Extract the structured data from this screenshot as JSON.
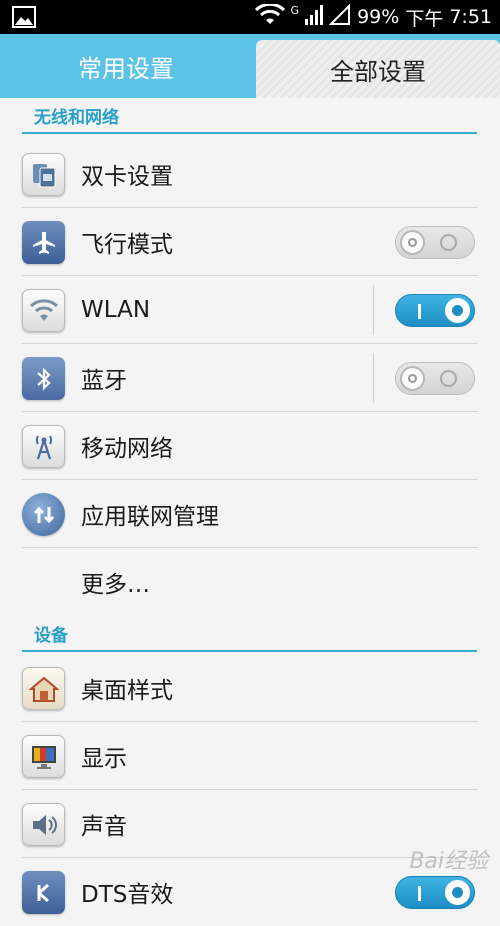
{
  "status_bar": {
    "signal_type": "G",
    "battery": "99%",
    "time_period": "下午",
    "time": "7:51",
    "icons": [
      "image-icon",
      "wifi-icon",
      "signal-icon",
      "signal-empty-icon"
    ]
  },
  "tabs": [
    {
      "label": "常用设置",
      "selected": false
    },
    {
      "label": "全部设置",
      "selected": true
    }
  ],
  "sections": [
    {
      "header": "无线和网络",
      "items": [
        {
          "label": "双卡设置",
          "icon": "dual-sim-icon"
        },
        {
          "label": "飞行模式",
          "icon": "airplane-icon",
          "toggle": "off"
        },
        {
          "label": "WLAN",
          "icon": "wifi-icon",
          "toggle": "on"
        },
        {
          "label": "蓝牙",
          "icon": "bluetooth-icon",
          "toggle": "off"
        },
        {
          "label": "移动网络",
          "icon": "antenna-icon"
        },
        {
          "label": "应用联网管理",
          "icon": "network-globe-icon"
        },
        {
          "label": "更多…",
          "icon": ""
        }
      ]
    },
    {
      "header": "设备",
      "items": [
        {
          "label": "桌面样式",
          "icon": "home-icon"
        },
        {
          "label": "显示",
          "icon": "display-icon"
        },
        {
          "label": "声音",
          "icon": "speaker-icon"
        },
        {
          "label": "DTS音效",
          "icon": "dts-icon",
          "toggle": "on"
        }
      ]
    }
  ],
  "watermark": "Bai经验",
  "colors": {
    "accent": "#38a9d0",
    "tab_bar": "#5cc3e6"
  }
}
